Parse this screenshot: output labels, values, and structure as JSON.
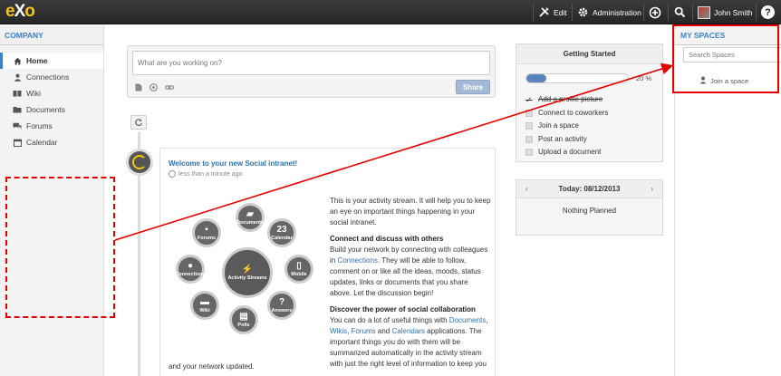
{
  "topbar": {
    "logo_e": "e",
    "logo_x": "X",
    "logo_o": "o",
    "edit_label": "Edit",
    "admin_label": "Administration",
    "user_name": "John Smith",
    "help_label": "?"
  },
  "left_sidebar": {
    "header": "COMPANY",
    "items": [
      {
        "label": "Home",
        "icon": "home-icon",
        "active": true
      },
      {
        "label": "Connections",
        "icon": "person-icon"
      },
      {
        "label": "Wiki",
        "icon": "book-icon"
      },
      {
        "label": "Documents",
        "icon": "folder-icon"
      },
      {
        "label": "Forums",
        "icon": "chat-icon"
      },
      {
        "label": "Calendar",
        "icon": "calendar-icon"
      }
    ]
  },
  "composer": {
    "placeholder": "What are you working on?",
    "share_label": "Share"
  },
  "post": {
    "title": "Welcome to your new Social intranet!",
    "time": "less than a minute ago",
    "intro": "This is your activity stream. It will help you to keep an eye on important things happening in your social intranet.",
    "h1": "Connect and discuss with others",
    "p1_a": "Build your network by connecting with colleagues in ",
    "p1_link": "Connections",
    "p1_b": ". They will be able to follow, comment on or like all the ideas, moods, status updates, links or documents that you share above. Let the discussion begin!",
    "h2": "Discover the power of social collaboration",
    "p2_a": "You can do a lot of useful things with ",
    "p2_l1": "Documents",
    "p2_sep1": ", ",
    "p2_l2": "Wikis",
    "p2_sep2": ", ",
    "p2_l3": "Forums",
    "p2_and": " and ",
    "p2_l4": "Calendars",
    "p2_b": " applications. The important things you do with them will be summarized automatically in the activity stream with just the right level of information to keep you",
    "tail": "and your network updated.",
    "diagram": {
      "center": "Activity Streams",
      "nodes": [
        "Documents",
        "Calendar",
        "Forums",
        "Connections",
        "Mobile",
        "Wiki",
        "Polls",
        "Answers"
      ],
      "calendar_num": "23"
    }
  },
  "getting_started": {
    "title": "Getting Started",
    "progress": 20,
    "progress_label": "20 %",
    "tasks": [
      {
        "label": "Add a profile picture",
        "done": true
      },
      {
        "label": "Connect to coworkers",
        "done": false
      },
      {
        "label": "Join a space",
        "done": false
      },
      {
        "label": "Post an activity",
        "done": false
      },
      {
        "label": "Upload a document",
        "done": false
      }
    ]
  },
  "calendar": {
    "prev": "‹",
    "title": "Today: 08/12/2013",
    "next": "›",
    "empty": "Nothing Planned"
  },
  "spaces": {
    "header": "MY SPACES",
    "search_placeholder": "Search Spaces",
    "join_label": "Join a space"
  },
  "colors": {
    "accent": "#3f80c5",
    "annotation": "#e50000",
    "logo": "#f5c518"
  }
}
